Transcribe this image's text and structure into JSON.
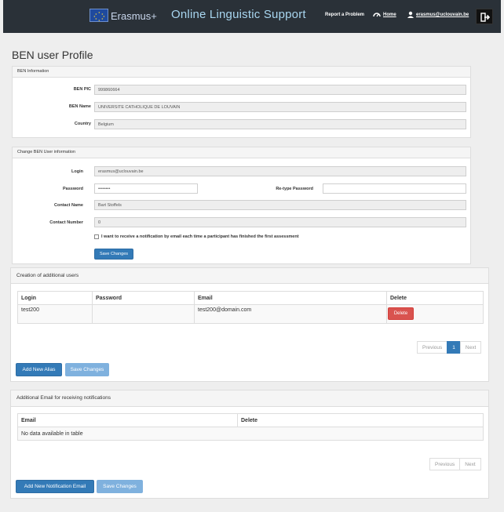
{
  "header": {
    "brand": "Erasmus+",
    "app_title": "Online Linguistic Support",
    "report_link": "Report a Problem",
    "home_link": "Home",
    "user_email": "erasmus@uclouvain.be"
  },
  "page_title": "BEN user Profile",
  "ben_info": {
    "heading": "BEN Information",
    "pic_label": "BEN PIC",
    "pic_value": "999860664",
    "name_label": "BEN Name",
    "name_value": "UNIVERSITE CATHOLIQUE DE LOUVAIN",
    "country_label": "Country",
    "country_value": "Belgium"
  },
  "change_info": {
    "heading": "Change BEN User information",
    "login_label": "Login",
    "login_value": "erasmus@uclouvain.be",
    "password_label": "Password",
    "password_value": "••••••••",
    "retype_label": "Re-type Password",
    "retype_value": "",
    "contact_name_label": "Contact Name",
    "contact_name_value": "Bart Stoffels",
    "contact_number_label": "Contact Number",
    "contact_number_value": "0",
    "notify_text": "I want to receive a notification by email each time a participant has finished the first assessment",
    "save_label": "Save Changes"
  },
  "additional_users": {
    "heading": "Creation of additional users",
    "columns": [
      "Login",
      "Password",
      "Email",
      "Delete"
    ],
    "rows": [
      {
        "login": "test200",
        "password": "",
        "email": "test200@domain.com",
        "delete_label": "Delete"
      }
    ],
    "pager": {
      "prev": "Previous",
      "page": "1",
      "next": "Next"
    },
    "add_label": "Add New Alias",
    "save_label": "Save Changes"
  },
  "additional_email": {
    "heading": "Additional Email for receiving notifications",
    "columns": [
      "Email",
      "Delete"
    ],
    "empty_text": "No data available in table",
    "pager": {
      "prev": "Previous",
      "next": "Next"
    },
    "add_label": "Add New Notification Email",
    "save_label": "Save Changes"
  },
  "colors": {
    "header_bg": "#2a3138",
    "primary": "#337ab7",
    "danger": "#d9534f"
  },
  "icons": [
    "eu-flag-icon",
    "dashboard-icon",
    "user-icon",
    "logout-icon"
  ]
}
